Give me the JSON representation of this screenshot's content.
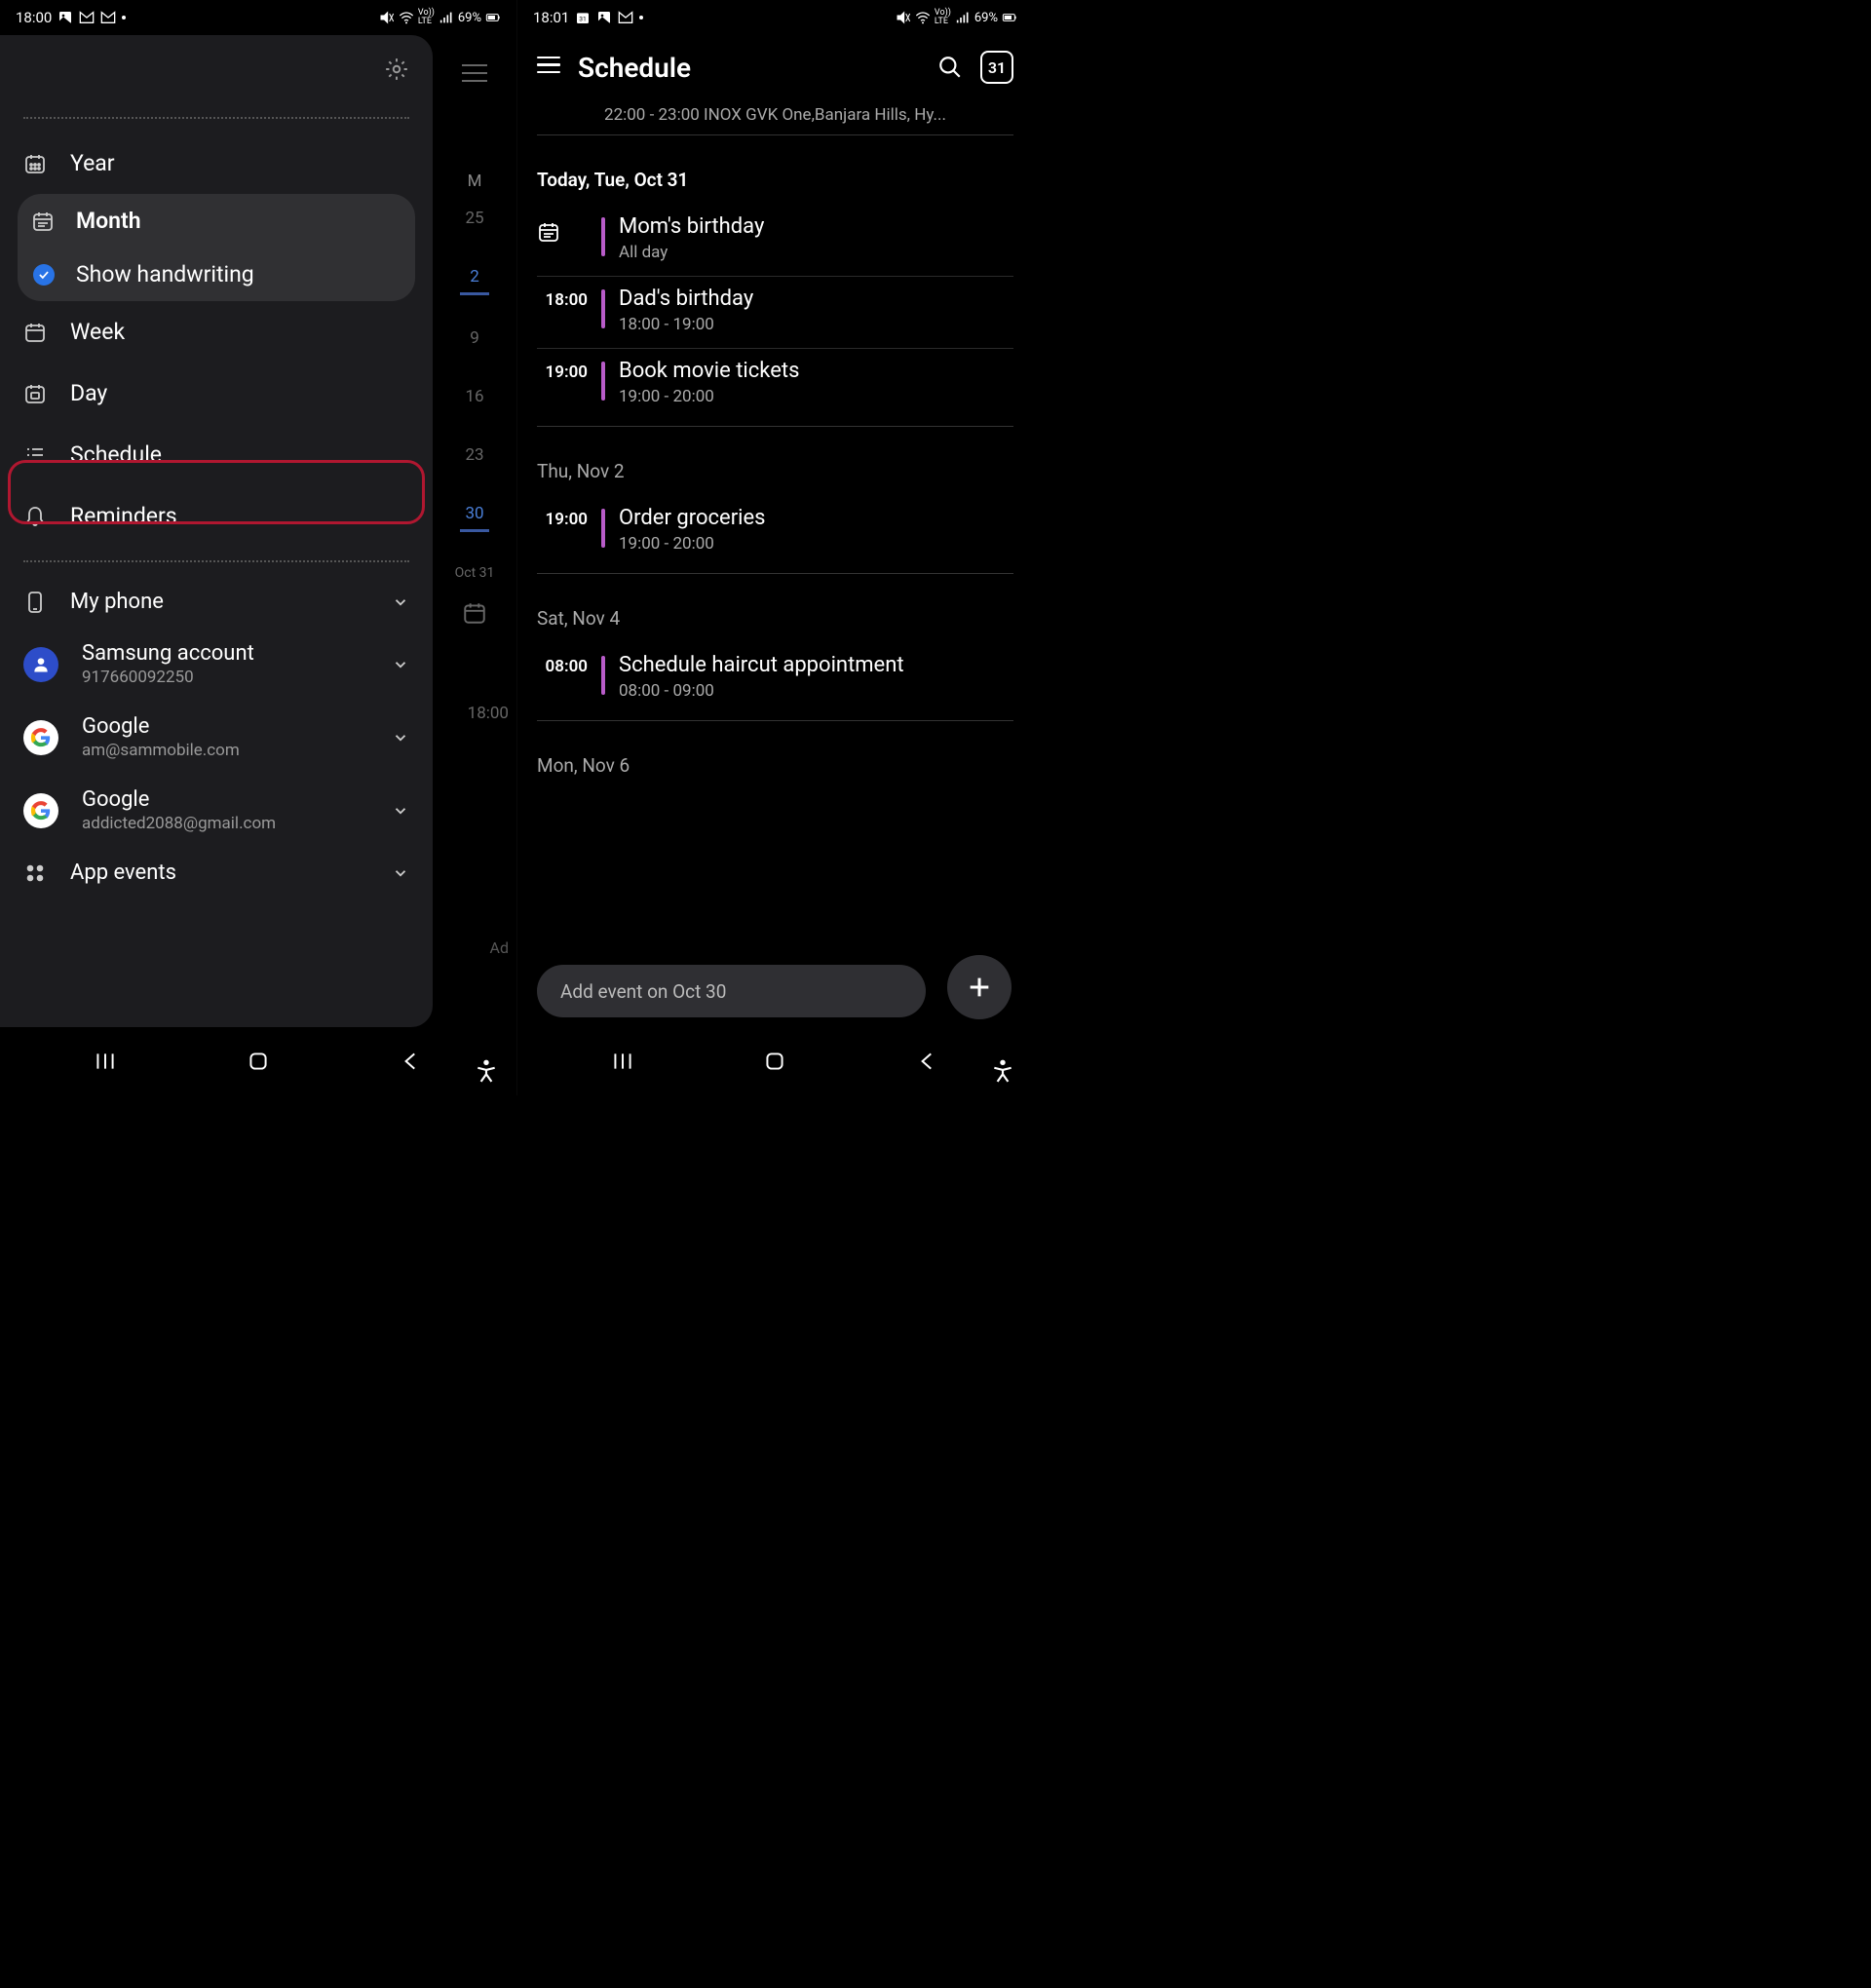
{
  "left": {
    "status": {
      "time": "18:00",
      "battery": "69%"
    },
    "drawer": {
      "views": {
        "year": "Year",
        "month": "Month",
        "show_handwriting": "Show handwriting",
        "week": "Week",
        "day": "Day",
        "schedule": "Schedule",
        "reminders": "Reminders"
      },
      "accounts": {
        "my_phone": "My phone",
        "samsung": {
          "title": "Samsung account",
          "sub": "917660092250"
        },
        "google1": {
          "title": "Google",
          "sub": "am@sammobile.com"
        },
        "google2": {
          "title": "Google",
          "sub": "addicted2088@gmail.com"
        },
        "app_events": "App events"
      }
    },
    "background": {
      "day_letter": "M",
      "days": [
        "25",
        "2",
        "9",
        "16",
        "23",
        "30"
      ],
      "date_label": "Oct 31",
      "time_label": "18:00",
      "add_label": "Ad"
    }
  },
  "right": {
    "status": {
      "time": "18:01",
      "battery": "69%"
    },
    "header": {
      "title": "Schedule",
      "date_badge": "31"
    },
    "truncated": "22:00 - 23:00 INOX GVK One,Banjara Hills, Hy...",
    "today": {
      "header": "Today, Tue, Oct 31",
      "events": [
        {
          "icon": true,
          "title": "Mom's birthday",
          "sub": "All day"
        },
        {
          "time": "18:00",
          "title": "Dad's birthday",
          "sub": "18:00 - 19:00"
        },
        {
          "time": "19:00",
          "title": "Book movie tickets",
          "sub": "19:00 - 20:00"
        }
      ]
    },
    "nov2": {
      "header": "Thu, Nov 2",
      "event": {
        "time": "19:00",
        "title": "Order groceries",
        "sub": "19:00 - 20:00"
      }
    },
    "nov4": {
      "header": "Sat, Nov 4",
      "event": {
        "time": "08:00",
        "title": "Schedule haircut appointment",
        "sub": "08:00 - 09:00"
      }
    },
    "nov6": {
      "header": "Mon, Nov 6"
    },
    "add_bar": "Add event on Oct 30"
  }
}
